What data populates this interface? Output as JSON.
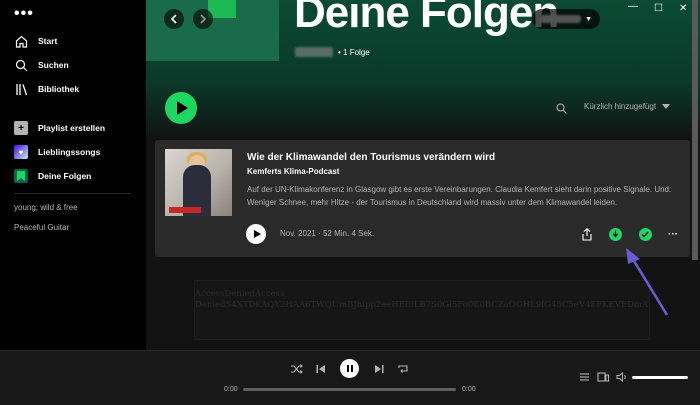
{
  "sidebar": {
    "menu_label": "•••",
    "nav": [
      {
        "label": "Start",
        "icon": "home-icon"
      },
      {
        "label": "Suchen",
        "icon": "search-icon"
      },
      {
        "label": "Bibliothek",
        "icon": "library-icon"
      }
    ],
    "actions": [
      {
        "label": "Playlist erstellen",
        "icon": "plus-icon"
      },
      {
        "label": "Lieblingssongs",
        "icon": "heart-icon"
      },
      {
        "label": "Deine Folgen",
        "icon": "bookmark-icon"
      }
    ],
    "playlists": [
      "young, wild & free",
      "Peaceful Guitar"
    ]
  },
  "header": {
    "title": "Deine Folgen",
    "episode_count": "• 1 Folge"
  },
  "toolbar": {
    "sort_label": "Kürzlich hinzugefügt"
  },
  "episode": {
    "title": "Wie der Klimawandel den Tourismus verändern wird",
    "show": "Kemferts Klima-Podcast",
    "description": "Auf der UN-Klimakonferenz in Glasgow gibt es erste Vereinbarungen. Claudia Kemfert sieht darin positive Signale. Und: Weniger Schnee, mehr Hitze - der Tourismus in Deutschland wird massiv unter dem Klimawandel leiden.",
    "meta": "Nov. 2021 · 52 Min. 4 Sek.",
    "more_label": "···"
  },
  "token": {
    "line1": "AccessDeniedAccess",
    "line2": "DeniedS4XTDKAQY2HAA6TWQUmBJhipp2eeHEEiLB7S0Gl5Fo0E0BCZaOOHL9fG45C5eV4FFKEVEDmA2Laed"
  },
  "player": {
    "time_current": "0:00",
    "time_total": "0:00",
    "progress": 0,
    "volume": 1.0
  },
  "colors": {
    "accent": "#1ed760",
    "arrow": "#6b5bd6"
  }
}
